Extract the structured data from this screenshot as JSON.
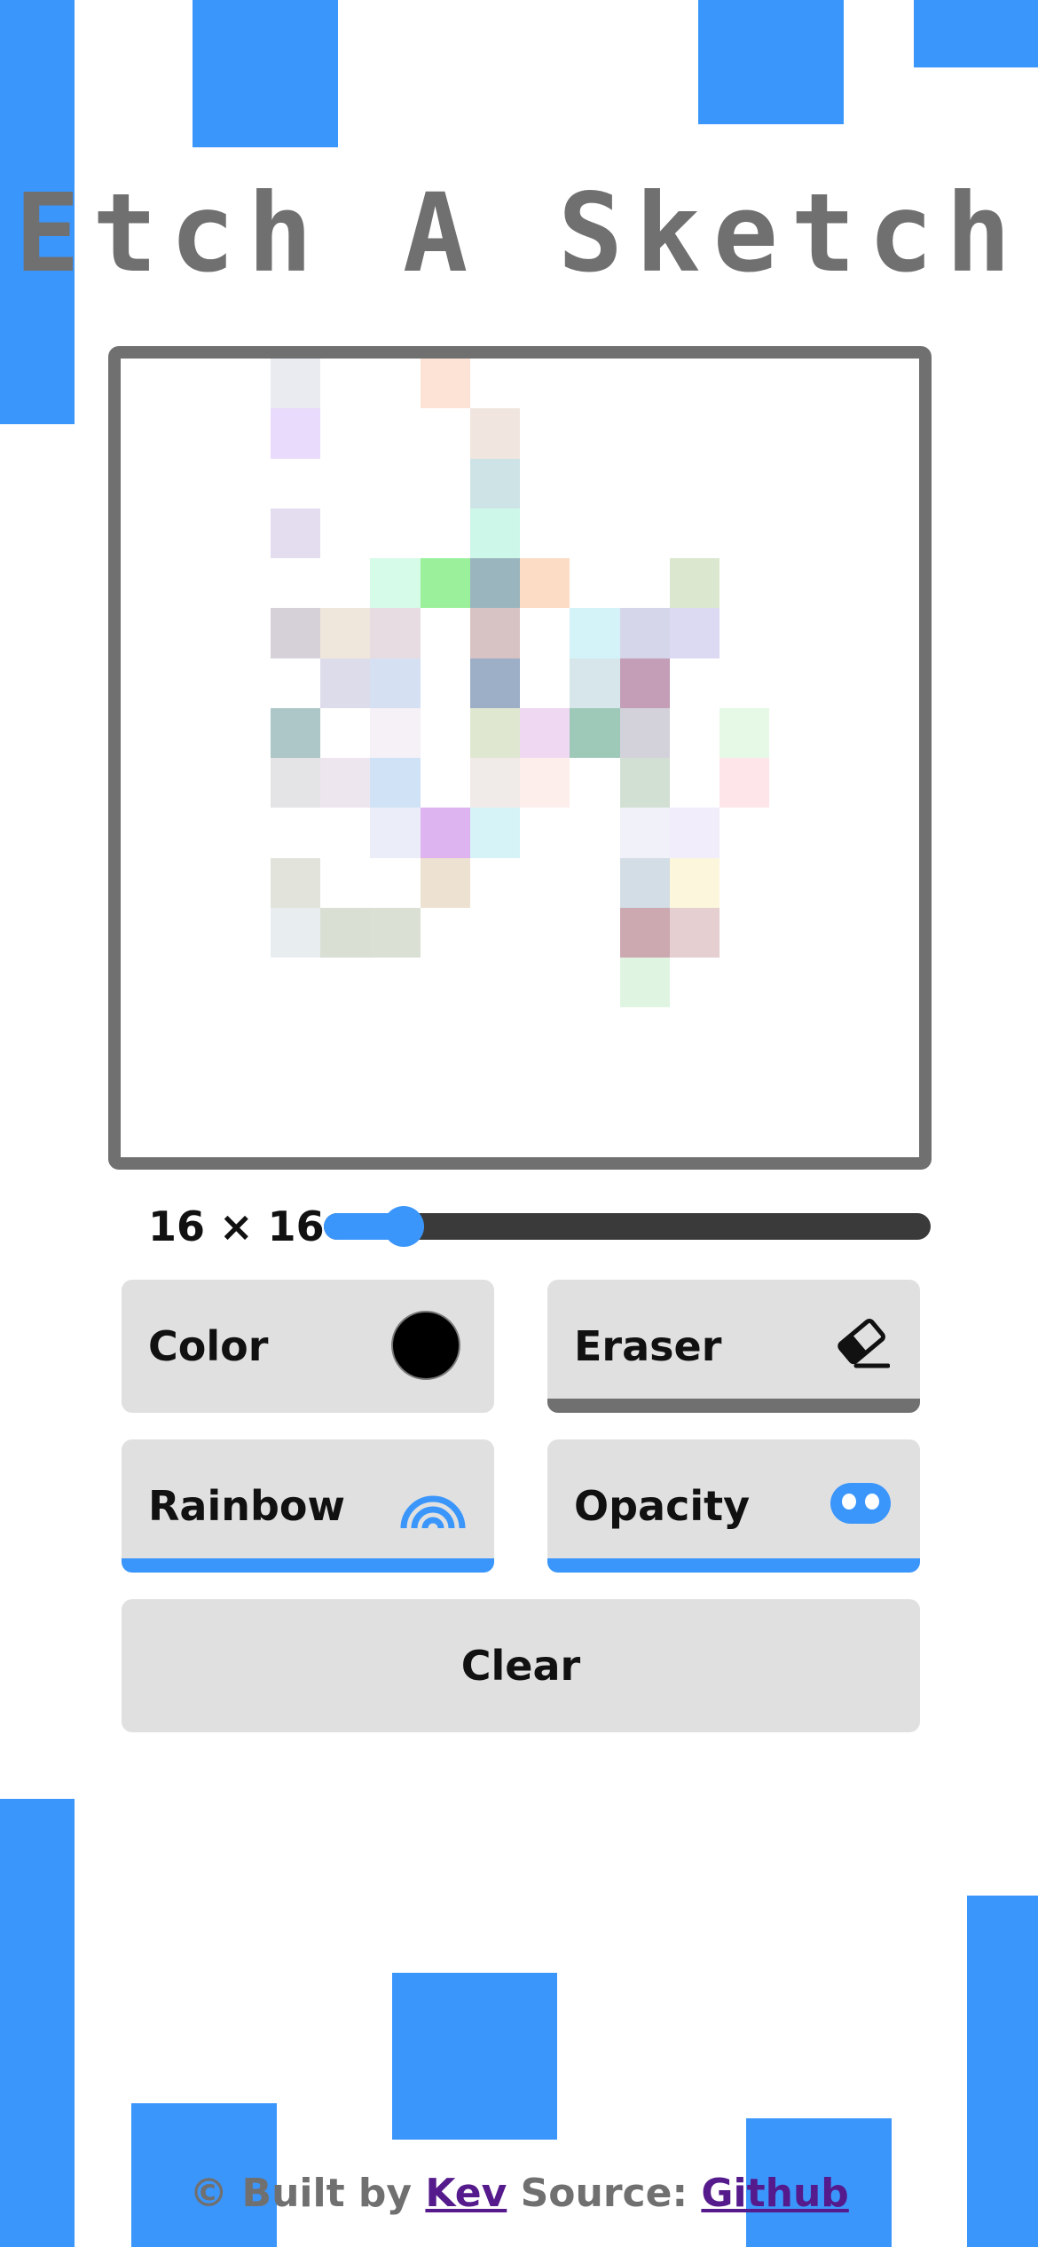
{
  "theme": {
    "accent": "#3b96fc",
    "frame": "#707070",
    "button_bg": "#e0e0e0",
    "slider_track": "#3a3a3a",
    "link": "#551a8b"
  },
  "title": "Etch A Sketch",
  "grid": {
    "rows": 16,
    "cols": 16,
    "painted": [
      [
        0,
        3,
        "#e9ebf0"
      ],
      [
        0,
        6,
        "#fde3d6"
      ],
      [
        1,
        3,
        "#e8dbfb"
      ],
      [
        1,
        7,
        "#f0e6df"
      ],
      [
        2,
        7,
        "#cde3e6"
      ],
      [
        3,
        3,
        "#e4ddef"
      ],
      [
        3,
        7,
        "#ccf7e9"
      ],
      [
        4,
        5,
        "#d6fbe9"
      ],
      [
        4,
        6,
        "#9bf09b"
      ],
      [
        4,
        7,
        "#9bb5be"
      ],
      [
        4,
        8,
        "#fcdcc5"
      ],
      [
        4,
        11,
        "#dbe7cf"
      ],
      [
        5,
        3,
        "#d6d1d8"
      ],
      [
        5,
        4,
        "#efe7dc"
      ],
      [
        5,
        5,
        "#e7dce2"
      ],
      [
        5,
        7,
        "#d8c3c4"
      ],
      [
        5,
        9,
        "#d3f3f9"
      ],
      [
        5,
        10,
        "#d6d6ea"
      ],
      [
        5,
        11,
        "#dcdaf2"
      ],
      [
        6,
        4,
        "#dddcea"
      ],
      [
        6,
        5,
        "#d5e0f2"
      ],
      [
        6,
        7,
        "#9daec7"
      ],
      [
        6,
        9,
        "#d6e6ea"
      ],
      [
        6,
        10,
        "#c39eb6"
      ],
      [
        7,
        3,
        "#adc6c7"
      ],
      [
        7,
        5,
        "#f6f0f7"
      ],
      [
        7,
        7,
        "#dfe7d1"
      ],
      [
        7,
        8,
        "#efd8f1"
      ],
      [
        7,
        9,
        "#9ec9b9"
      ],
      [
        7,
        10,
        "#d3d2da"
      ],
      [
        7,
        12,
        "#e6f8e6"
      ],
      [
        8,
        3,
        "#e4e4e6"
      ],
      [
        8,
        4,
        "#ede6ef"
      ],
      [
        8,
        5,
        "#cfe2f6"
      ],
      [
        8,
        7,
        "#f0ebe8"
      ],
      [
        8,
        8,
        "#fdeeec"
      ],
      [
        8,
        10,
        "#d2e0d3"
      ],
      [
        8,
        12,
        "#fde5ea"
      ],
      [
        9,
        5,
        "#ebedf9"
      ],
      [
        9,
        6,
        "#ddb3f0"
      ],
      [
        9,
        7,
        "#d6f3f8"
      ],
      [
        9,
        10,
        "#f0f1f9"
      ],
      [
        9,
        11,
        "#f1edfb"
      ],
      [
        10,
        3,
        "#e2e3db"
      ],
      [
        10,
        6,
        "#ede1d1"
      ],
      [
        10,
        10,
        "#d3dde5"
      ],
      [
        10,
        11,
        "#fbf6dc"
      ],
      [
        11,
        3,
        "#e8eeef"
      ],
      [
        11,
        4,
        "#dadfd3"
      ],
      [
        11,
        5,
        "#dbe0d4"
      ],
      [
        11,
        10,
        "#cca8b1"
      ],
      [
        11,
        11,
        "#e5cfd1"
      ],
      [
        12,
        10,
        "#e0f5e1"
      ]
    ]
  },
  "size_label": "16 × 16",
  "slider": {
    "value": 16,
    "min": 2,
    "max": 100
  },
  "buttons": {
    "color": {
      "label": "Color",
      "swatch": "#000000"
    },
    "eraser": {
      "label": "Eraser",
      "indicator": "#707070"
    },
    "rainbow": {
      "label": "Rainbow",
      "indicator": "#3b96fc"
    },
    "opacity": {
      "label": "Opacity",
      "indicator": "#3b96fc"
    },
    "clear": {
      "label": "Clear"
    }
  },
  "footer": {
    "prefix": "© Built by",
    "author": "Kev",
    "source_label": "Source:",
    "source_link": "Github"
  }
}
